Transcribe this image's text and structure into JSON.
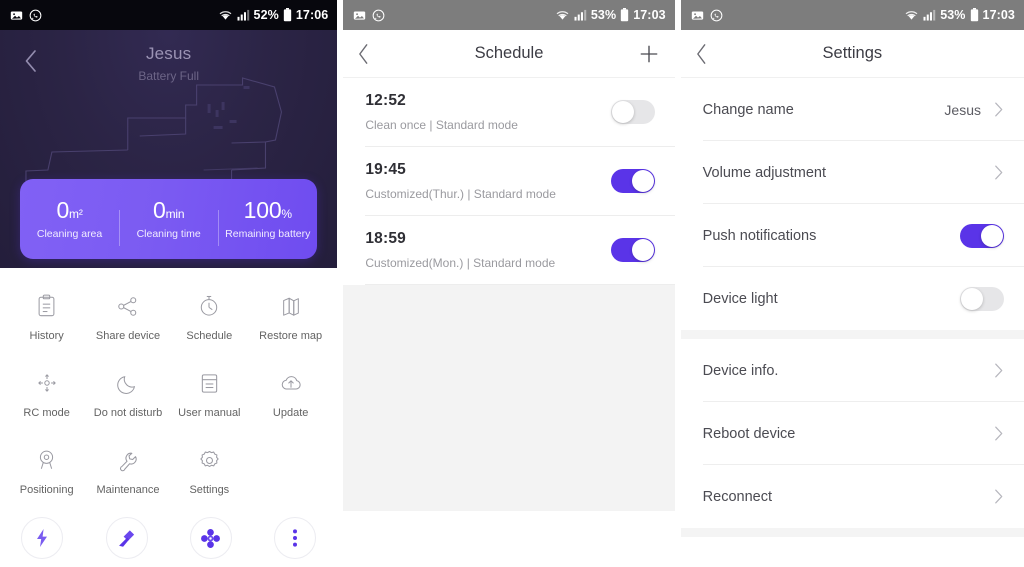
{
  "statusbars": {
    "device1": {
      "battery": "52%",
      "time": "17:06",
      "icons": [
        "image-icon",
        "whatsapp-icon",
        "wifi-icon",
        "signal-icon",
        "battery-icon"
      ]
    },
    "device2": {
      "battery": "53%",
      "time": "17:03",
      "icons": [
        "image-icon",
        "whatsapp-icon",
        "wifi-icon",
        "signal-icon",
        "battery-icon"
      ]
    },
    "device3": {
      "battery": "53%",
      "time": "17:03",
      "icons": [
        "image-icon",
        "whatsapp-icon",
        "wifi-icon",
        "signal-icon",
        "battery-icon"
      ]
    }
  },
  "colors": {
    "accent_purple": "#5a34e8",
    "card_purple_start": "#8161f5",
    "card_purple_end": "#6f4cf0",
    "map_dark": "#2b2445",
    "status_dark": "#07070d",
    "status_grey": "#7d7d7d",
    "switch_off": "#e6e6e8"
  },
  "home": {
    "back_icon": "chevron-left-icon",
    "device_name": "Jesus",
    "device_status": "Battery Full",
    "stats": [
      {
        "value": "0",
        "unit": "m²",
        "label": "Cleaning area"
      },
      {
        "value": "0",
        "unit": "min",
        "label": "Cleaning time"
      },
      {
        "value": "100",
        "unit": "%",
        "label": "Remaining battery"
      }
    ],
    "features": [
      {
        "label": "History",
        "icon": "clipboard-icon"
      },
      {
        "label": "Share device",
        "icon": "share-icon"
      },
      {
        "label": "Schedule",
        "icon": "stopwatch-icon"
      },
      {
        "label": "Restore map",
        "icon": "map-icon"
      },
      {
        "label": "RC mode",
        "icon": "dpad-icon"
      },
      {
        "label": "Do not disturb",
        "icon": "moon-icon"
      },
      {
        "label": "User manual",
        "icon": "document-icon"
      },
      {
        "label": "Update",
        "icon": "cloud-upload-icon"
      },
      {
        "label": "Positioning",
        "icon": "location-pin-icon"
      },
      {
        "label": "Maintenance",
        "icon": "wrench-icon"
      },
      {
        "label": "Settings",
        "icon": "gear-icon"
      }
    ],
    "actions": [
      {
        "name": "charge-button",
        "icon": "lightning-icon"
      },
      {
        "name": "clean-button",
        "icon": "broom-icon"
      },
      {
        "name": "fan-button",
        "icon": "fan-icon"
      },
      {
        "name": "more-button",
        "icon": "three-dots-icon"
      }
    ]
  },
  "schedule": {
    "back_icon": "chevron-left-icon",
    "title": "Schedule",
    "add_icon": "plus-icon",
    "items": [
      {
        "time": "12:52",
        "desc": "Clean once | Standard mode",
        "enabled": false
      },
      {
        "time": "19:45",
        "desc": "Customized(Thur.) | Standard mode",
        "enabled": true
      },
      {
        "time": "18:59",
        "desc": "Customized(Mon.) | Standard mode",
        "enabled": true
      }
    ]
  },
  "settings": {
    "back_icon": "chevron-left-icon",
    "title": "Settings",
    "group1": [
      {
        "label": "Change name",
        "value": "Jesus",
        "type": "link",
        "chevron": true
      },
      {
        "label": "Volume adjustment",
        "value": "",
        "type": "link",
        "chevron": true
      },
      {
        "label": "Push notifications",
        "value": "",
        "type": "switch",
        "enabled": true
      },
      {
        "label": "Device light",
        "value": "",
        "type": "switch",
        "enabled": false
      }
    ],
    "group2": [
      {
        "label": "Device info.",
        "value": "",
        "type": "link",
        "chevron": true
      },
      {
        "label": "Reboot device",
        "value": "",
        "type": "link",
        "chevron": true
      },
      {
        "label": "Reconnect",
        "value": "",
        "type": "link",
        "chevron": true
      }
    ]
  }
}
